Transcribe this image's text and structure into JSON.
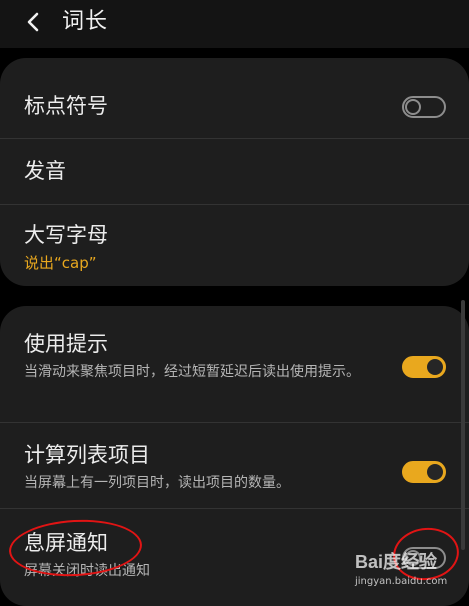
{
  "header": {
    "back_icon": "chevron-left-icon",
    "title": "词长"
  },
  "sections": [
    {
      "items": [
        {
          "label": "标点符号",
          "toggle": "off"
        },
        {
          "label": "发音"
        },
        {
          "label": "大写字母",
          "subtitle": "说出“cap”"
        }
      ]
    },
    {
      "items": [
        {
          "label": "使用提示",
          "subtitle": "当滑动来聚焦项目时，经过短暂延迟后读出使用提示。",
          "toggle": "on"
        },
        {
          "label": "计算列表项目",
          "subtitle": "当屏幕上有一列项目时，读出项目的数量。",
          "toggle": "on"
        },
        {
          "label": "息屏通知",
          "subtitle": "屏幕关闭时读出通知",
          "toggle": "off"
        }
      ]
    }
  ],
  "watermark": {
    "text": "Bai度经验",
    "url": "jingyan.baidu.com"
  },
  "colors": {
    "accent": "#e9a81e",
    "background": "#000000",
    "card": "#1e1e1e",
    "annotation": "#e11414"
  }
}
